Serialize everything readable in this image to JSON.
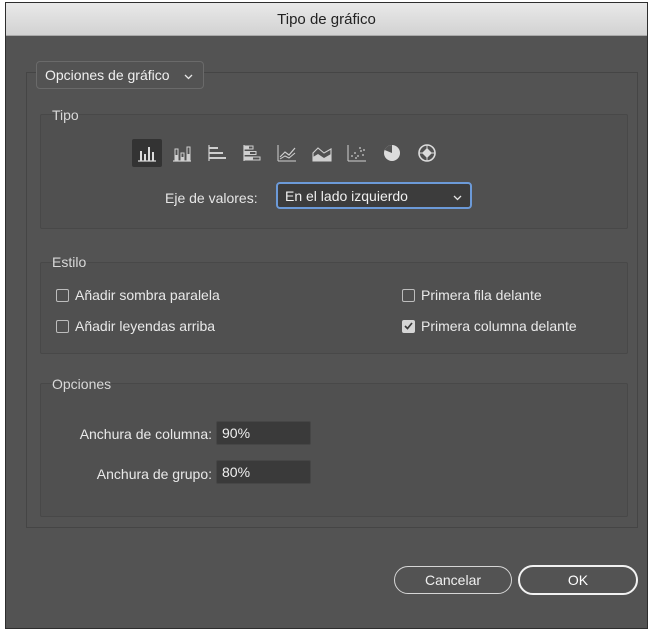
{
  "window": {
    "title": "Tipo de gráfico"
  },
  "panel_select": {
    "value": "Opciones de gráfico"
  },
  "tipo": {
    "label": "Tipo",
    "icons": [
      "column-chart-icon",
      "stacked-column-chart-icon",
      "bar-chart-icon",
      "stacked-bar-chart-icon",
      "line-chart-icon",
      "area-chart-icon",
      "scatter-chart-icon",
      "pie-chart-icon",
      "radar-chart-icon"
    ],
    "selected_index": 0,
    "axis_label": "Eje de valores:",
    "axis_value": "En el lado izquierdo"
  },
  "estilo": {
    "label": "Estilo",
    "drop_shadow": {
      "label": "Añadir sombra paralela",
      "checked": false
    },
    "legends_top": {
      "label": "Añadir leyendas arriba",
      "checked": false
    },
    "first_row_front": {
      "label": "Primera fila delante",
      "checked": false
    },
    "first_col_front": {
      "label": "Primera columna delante",
      "checked": true
    }
  },
  "opciones": {
    "label": "Opciones",
    "column_width_label": "Anchura de columna:",
    "column_width": "90%",
    "group_width_label": "Anchura de grupo:",
    "group_width": "80%"
  },
  "buttons": {
    "cancel": "Cancelar",
    "ok": "OK"
  },
  "colors": {
    "background": "#535353",
    "accent": "#6c9ad8",
    "titlebar": "#dcdcdc"
  }
}
